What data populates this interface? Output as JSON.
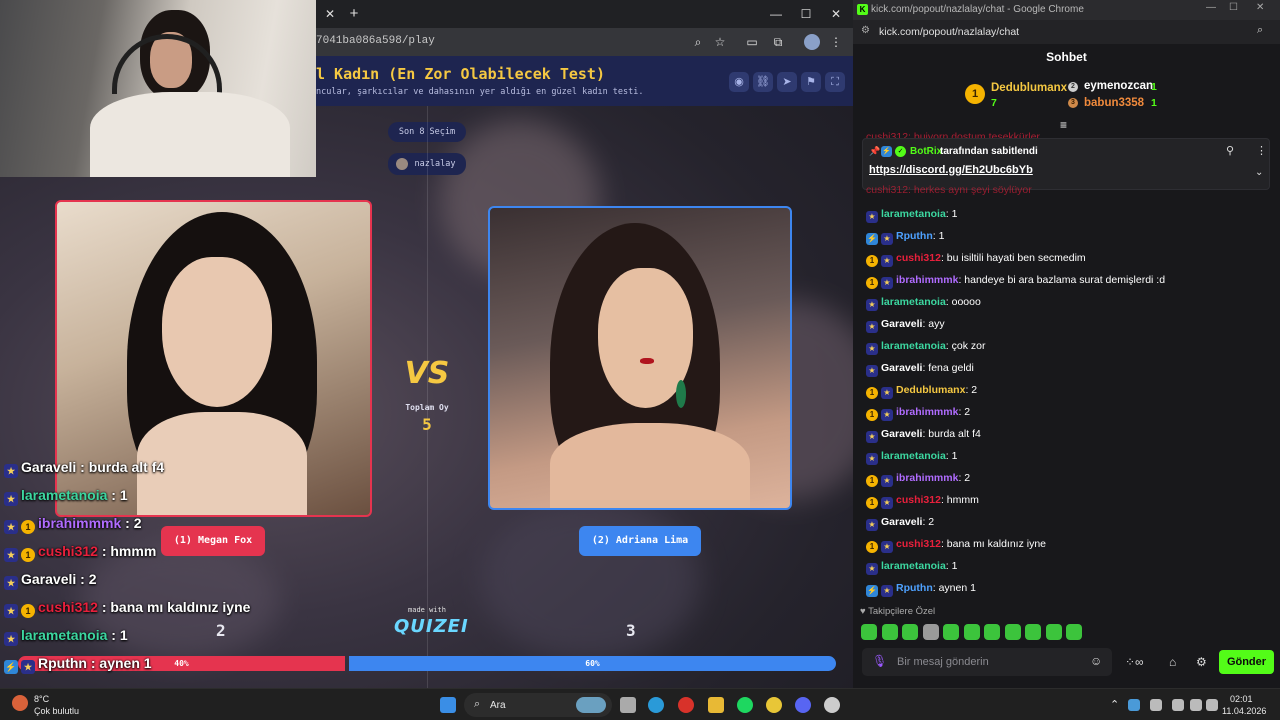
{
  "game_browser": {
    "url": "7041ba086a598/play",
    "quiz_title": "l Kadın (En Zor Olabilecek Test)",
    "quiz_subtitle": "ncular, şarkıcılar ve dahasının yer aldığı en güzel kadın testi.",
    "round_label": "Son 8 Seçim",
    "host_name": "nazlalay",
    "left_choice": "(1) Megan Fox",
    "right_choice": "(2) Adriana Lima",
    "vs_label": "VS",
    "total_votes_label": "Toplam Oy",
    "total_votes": "5",
    "left_count": "2",
    "right_count": "3",
    "left_percent": "40%",
    "right_percent": "60%",
    "made_with": "made with",
    "brand": "QUIZEI",
    "colors": {
      "left": "#e5344f",
      "right": "#3d86f0",
      "accent": "#f5c842"
    }
  },
  "overlay_chat": [
    {
      "user": "Garaveli",
      "text": " : burda alt f4",
      "user_color": "#ffffff",
      "badges": [
        "star"
      ]
    },
    {
      "user": "larametanoia",
      "text": " : 1",
      "user_color": "#3cd7a0",
      "badges": [
        "star"
      ]
    },
    {
      "user": "ibrahimmmk",
      "text": " : 2",
      "user_color": "#b06cff",
      "badges": [
        "star",
        "1"
      ]
    },
    {
      "user": "cushi312",
      "text": " : hmmm",
      "user_color": "#e8203c",
      "badges": [
        "star",
        "1"
      ]
    },
    {
      "user": "Garaveli",
      "text": " : 2",
      "user_color": "#ffffff",
      "badges": [
        "star"
      ]
    },
    {
      "user": "cushi312",
      "text": " : bana mı kaldınız iyne",
      "user_color": "#e8203c",
      "badges": [
        "star",
        "1"
      ]
    },
    {
      "user": "larametanoia",
      "text": " : 1",
      "user_color": "#3cd7a0",
      "badges": [
        "star"
      ]
    },
    {
      "user": "Rputhn",
      "text": " : aynen 1",
      "user_color": "#ffffff",
      "badges": [
        "bot",
        "star"
      ]
    }
  ],
  "chat_window": {
    "window_title": "kick.com/popout/nazlalay/chat - Google Chrome",
    "url": "kick.com/popout/nazlalay/chat",
    "heading": "Sohbet",
    "leaderboard": [
      {
        "rank": "1",
        "name": "Dedublumanx",
        "count": "7"
      },
      {
        "rank": "2",
        "name": "eymenozcan",
        "count": "1"
      },
      {
        "rank": "3",
        "name": "babun3358",
        "count": "1"
      }
    ],
    "partial_top": "cushi312: buiyorn dostum teşekkürler",
    "pinned": {
      "by": "BotRix",
      "suffix": " tarafından sabitlendi",
      "link": "https://discord.gg/Eh2Ubc6bYb"
    },
    "partial_under_pin": "cushi312: herkes aynı şeyi söylüyor",
    "messages": [
      {
        "user": "larametanoia",
        "text": ": 1",
        "color": "#3cd7a0",
        "badges": [
          "star"
        ]
      },
      {
        "user": "Rputhn",
        "text": ": 1",
        "color": "#4ea1ff",
        "badges": [
          "bot",
          "star"
        ]
      },
      {
        "user": "cushi312",
        "text": ": bu isiltili hayati ben secmedim",
        "color": "#e8203c",
        "badges": [
          "1",
          "star"
        ]
      },
      {
        "user": "ibrahimmmk",
        "text": ": handeye bi ara bazlama surat demişlerdi :d",
        "color": "#b06cff",
        "badges": [
          "1",
          "star"
        ]
      },
      {
        "user": "larametanoia",
        "text": ": ooooo",
        "color": "#3cd7a0",
        "badges": [
          "star"
        ]
      },
      {
        "user": "Garaveli",
        "text": ": ayy",
        "color": "#ffffff",
        "badges": [
          "star"
        ]
      },
      {
        "user": "larametanoia",
        "text": ": çok zor",
        "color": "#3cd7a0",
        "badges": [
          "star"
        ]
      },
      {
        "user": "Garaveli",
        "text": ": fena geldi",
        "color": "#ffffff",
        "badges": [
          "star"
        ]
      },
      {
        "user": "Dedublumanx",
        "text": ": 2",
        "color": "#f5c842",
        "badges": [
          "1",
          "star"
        ]
      },
      {
        "user": "ibrahimmmk",
        "text": ": 2",
        "color": "#b06cff",
        "badges": [
          "1",
          "star"
        ]
      },
      {
        "user": "Garaveli",
        "text": ": burda alt f4",
        "color": "#ffffff",
        "badges": [
          "star"
        ]
      },
      {
        "user": "larametanoia",
        "text": ": 1",
        "color": "#3cd7a0",
        "badges": [
          "star"
        ]
      },
      {
        "user": "ibrahimmmk",
        "text": ": 2",
        "color": "#b06cff",
        "badges": [
          "1",
          "star"
        ]
      },
      {
        "user": "cushi312",
        "text": ": hmmm",
        "color": "#e8203c",
        "badges": [
          "1",
          "star"
        ]
      },
      {
        "user": "Garaveli",
        "text": ": 2",
        "color": "#ffffff",
        "badges": [
          "star"
        ]
      },
      {
        "user": "cushi312",
        "text": ": bana mı kaldınız iyne",
        "color": "#e8203c",
        "badges": [
          "1",
          "star"
        ]
      },
      {
        "user": "larametanoia",
        "text": ": 1",
        "color": "#3cd7a0",
        "badges": [
          "star"
        ]
      },
      {
        "user": "Rputhn",
        "text": ": aynen 1",
        "color": "#4ea1ff",
        "badges": [
          "bot",
          "star"
        ]
      }
    ],
    "followers_only_label": "Takipçilere Özel",
    "input_placeholder": "Bir mesaj gönderin",
    "send_label": "Gönder",
    "brand_color": "#53fc18"
  },
  "taskbar": {
    "weather_temp": "8°C",
    "weather_desc": "Çok bulutlu",
    "search_label": "Ara",
    "time": "02:01",
    "date": "11.04.2026"
  }
}
